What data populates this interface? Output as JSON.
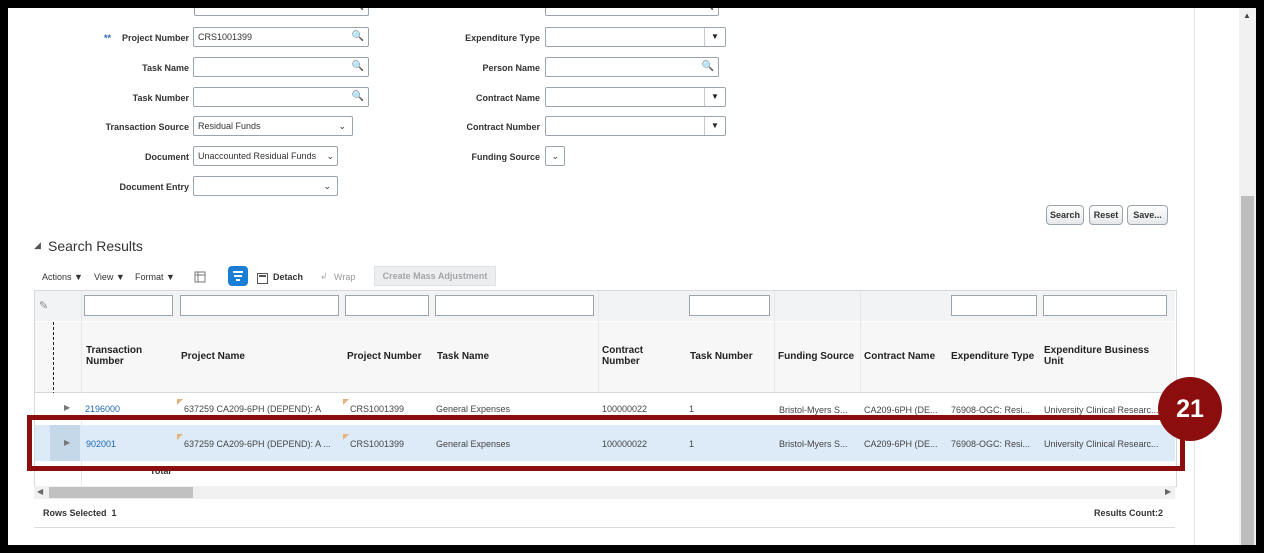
{
  "form": {
    "required_marker": "**",
    "project_number_label": "Project Number",
    "project_number_value": "CRS1001399",
    "task_name_label": "Task Name",
    "task_number_label": "Task Number",
    "transaction_source_label": "Transaction Source",
    "transaction_source_value": "Residual Funds",
    "document_label": "Document",
    "document_value": "Unaccounted Residual Funds",
    "document_entry_label": "Document Entry",
    "expenditure_type_label": "Expenditure Type",
    "person_name_label": "Person Name",
    "contract_name_label": "Contract Name",
    "contract_number_label": "Contract Number",
    "funding_source_label": "Funding Source"
  },
  "buttons": {
    "search": "Search",
    "reset": "Reset",
    "save": "Save..."
  },
  "results": {
    "section_title": "Search Results",
    "toolbar": {
      "actions": "Actions",
      "view": "View",
      "format": "Format",
      "detach": "Detach",
      "wrap": "Wrap",
      "create_mass_adjustment": "Create Mass Adjustment"
    },
    "columns": {
      "transaction_number": "Transaction Number",
      "project_name": "Project Name",
      "project_number": "Project Number",
      "task_name": "Task Name",
      "contract_number": "Contract Number",
      "task_number": "Task Number",
      "funding_source": "Funding Source",
      "contract_name": "Contract Name",
      "expenditure_type": "Expenditure Type",
      "expenditure_business_unit": "Expenditure Business Unit"
    },
    "rows": [
      {
        "transaction_number": "2196000",
        "project_name": "637259 CA209-6PH (DEPEND): A",
        "project_number": "CRS1001399",
        "task_name": "General Expenses",
        "contract_number": "100000022",
        "task_number": "1",
        "funding_source": "Bristol-Myers S...",
        "contract_name": "CA209-6PH (DE...",
        "expenditure_type": "76908-OGC: Resi...",
        "expenditure_business_unit": "University Clinical Researc..."
      },
      {
        "transaction_number": "902001",
        "project_name": "637259 CA209-6PH (DEPEND): A ...",
        "project_number": "CRS1001399",
        "task_name": "General Expenses",
        "contract_number": "100000022",
        "task_number": "1",
        "funding_source": "Bristol-Myers S...",
        "contract_name": "CA209-6PH (DE...",
        "expenditure_type": "76908-OGC: Resi...",
        "expenditure_business_unit": "University Clinical Researc..."
      }
    ],
    "total_label": "Total",
    "rows_selected": "Rows Selected  1",
    "results_count": "Results Count:2"
  },
  "callout": {
    "step_number": "21"
  },
  "colors": {
    "highlight": "#8b0d0d",
    "selected_row": "#dcebf7",
    "link": "#2068b4"
  },
  "icons": [
    "search-icon",
    "dropdown-arrow-icon",
    "chevron-down-icon",
    "freeze-icon",
    "query-filter-icon",
    "detach-icon",
    "wrap-icon",
    "edit-icon",
    "expand-row-icon"
  ]
}
